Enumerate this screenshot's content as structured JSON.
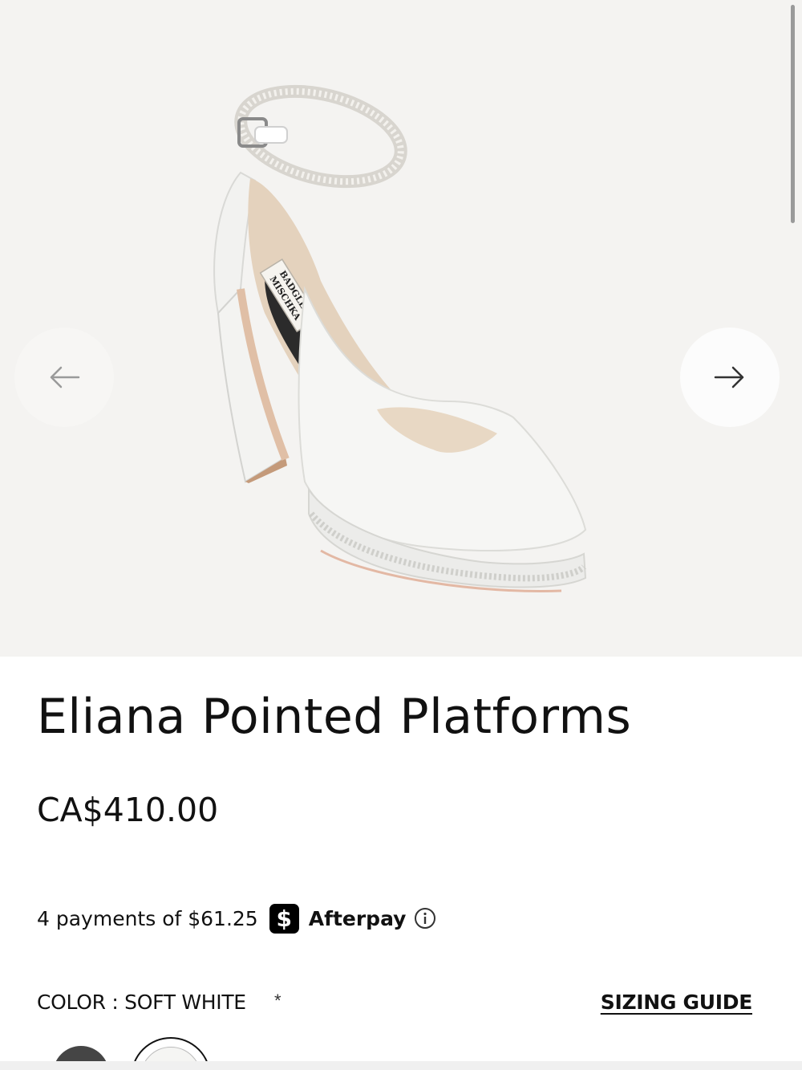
{
  "product": {
    "title": "Eliana Pointed Platforms",
    "price": "CA$410.00",
    "installment_text": "4 payments of $61.25",
    "installment_provider": "Afterpay",
    "installment_logo_glyph": "$",
    "color_label": "COLOR : SOFT WHITE",
    "required_mark": "*",
    "sizing_guide_label": "SIZING GUIDE"
  },
  "gallery": {
    "image_brand_text_line1": "BADGLEY",
    "image_brand_text_line2": "MISCHKA",
    "prev_icon": "arrow-left-icon",
    "next_icon": "arrow-right-icon"
  },
  "swatches": [
    {
      "name": "dark",
      "color": "#454545",
      "selected": false
    },
    {
      "name": "soft white",
      "color": "#f5f5f3",
      "selected": true
    }
  ],
  "colors": {
    "gallery_bg": "#f4f3f1",
    "text": "#111111",
    "afterpay_badge": "#000000"
  }
}
